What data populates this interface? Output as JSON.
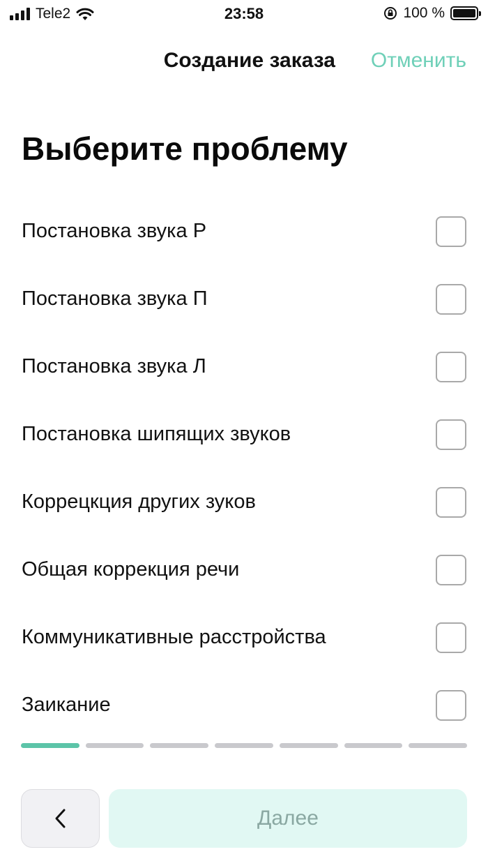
{
  "status_bar": {
    "carrier": "Tele2",
    "time": "23:58",
    "battery_percent": "100 %",
    "signal_icon": "signal-bars-icon",
    "wifi_icon": "wifi-icon",
    "orientation_lock_icon": "orientation-lock-icon",
    "battery_icon": "battery-icon"
  },
  "header": {
    "title": "Создание заказа",
    "cancel_label": "Отменить",
    "cancel_color": "#6fd0b8"
  },
  "page": {
    "heading": "Выберите проблему"
  },
  "options": [
    {
      "label": "Постановка звука Р",
      "checked": false
    },
    {
      "label": "Постановка звука П",
      "checked": false
    },
    {
      "label": "Постановка звука Л",
      "checked": false
    },
    {
      "label": "Постановка шипящих звуков",
      "checked": false
    },
    {
      "label": "Коррецкция других зуков",
      "checked": false
    },
    {
      "label": "Общая коррекция речи",
      "checked": false
    },
    {
      "label": "Коммуникативные расстройства",
      "checked": false
    },
    {
      "label": "Заикание",
      "checked": false
    }
  ],
  "progress": {
    "total_steps": 7,
    "current_step": 1,
    "active_color": "#5cc4a8",
    "inactive_color": "#c9c9cd"
  },
  "footer": {
    "back_icon": "chevron-left-icon",
    "next_label": "Далее",
    "next_bg_color": "#e1f8f3"
  }
}
